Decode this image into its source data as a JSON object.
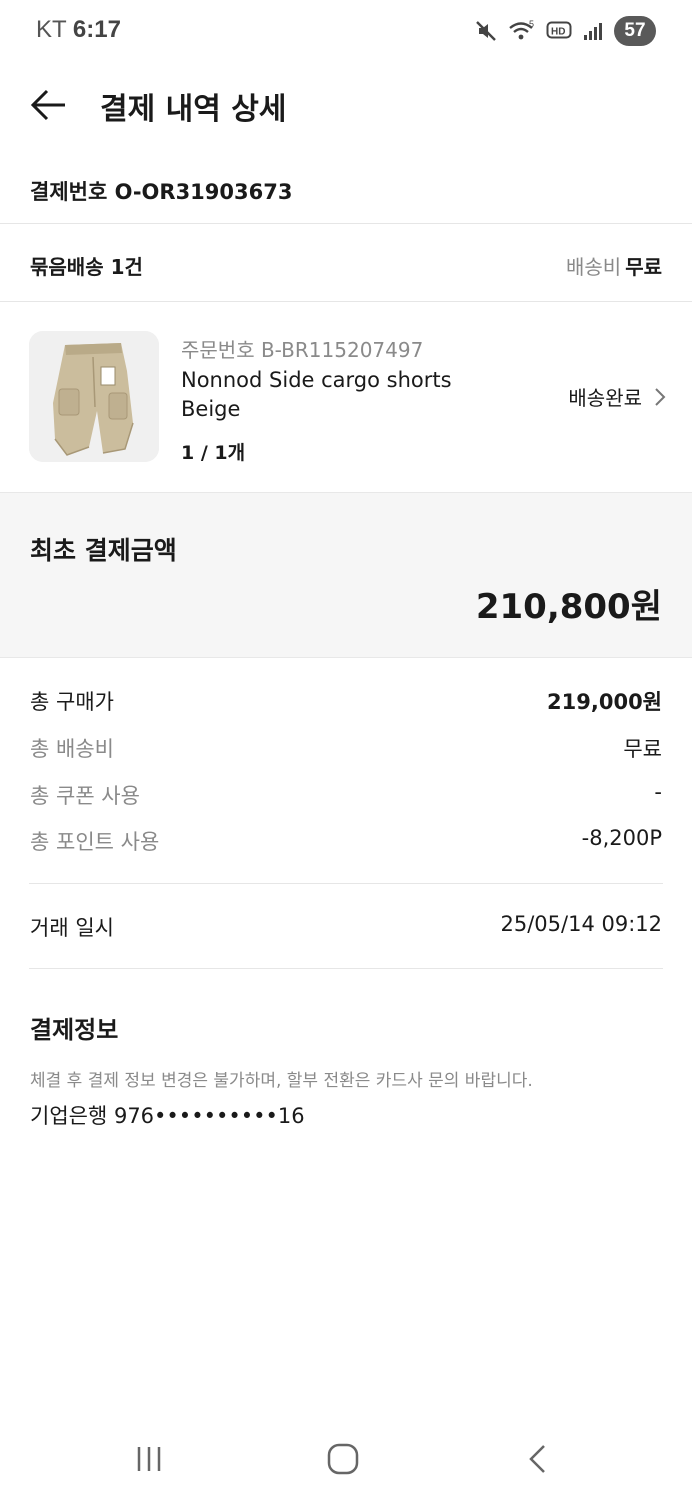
{
  "status_bar": {
    "carrier": "KT",
    "time": "6:17",
    "battery": "57",
    "icons": [
      "mute-icon",
      "wifi-icon",
      "hd-icon",
      "signal-icon",
      "battery-icon"
    ]
  },
  "header": {
    "title": "결제 내역 상세"
  },
  "order": {
    "number_label": "결제번호 O-OR31903673"
  },
  "bundle": {
    "label": "묶음배송 1건",
    "shipping_label": "배송비",
    "shipping_value": "무료"
  },
  "product": {
    "order_no": "주문번호 B-BR115207497",
    "name": "Nonnod Side cargo shorts Beige",
    "quantity": "1 / 1개",
    "status": "배송완료"
  },
  "initial_payment": {
    "label": "최초 결제금액",
    "amount": "210,800원"
  },
  "breakdown": {
    "items": [
      {
        "label": "총 구매가",
        "value": "219,000원"
      },
      {
        "label": "총 배송비",
        "value": "무료"
      },
      {
        "label": "총 쿠폰 사용",
        "value": "-"
      },
      {
        "label": "총 포인트 사용",
        "value": "-8,200P"
      }
    ]
  },
  "transaction": {
    "label": "거래 일시",
    "value": "25/05/14 09:12"
  },
  "payment_info": {
    "title": "결제정보",
    "note": "체결 후 결제 정보 변경은 불가하며, 할부 전환은 카드사 문의 바랍니다.",
    "card": "기업은행 976••••••••••16"
  },
  "colors": {
    "text": "#1a1a1a",
    "muted": "#8a8a8a",
    "panel_bg": "#f6f6f6",
    "divider": "#e6e6e6"
  }
}
